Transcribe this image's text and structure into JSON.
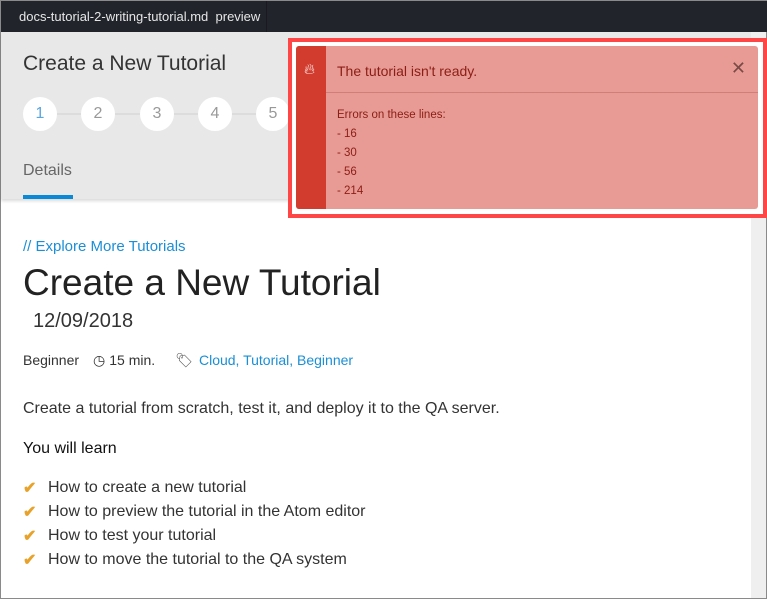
{
  "tab": {
    "title": "docs-tutorial-2-writing-tutorial.md  preview"
  },
  "header": {
    "title": "Create a New Tutorial",
    "steps": [
      "1",
      "2",
      "3",
      "4",
      "5"
    ],
    "active_tab": "Details"
  },
  "content": {
    "link": "// Explore More Tutorials",
    "title": "Create a New Tutorial",
    "date": "12/09/2018",
    "level": "Beginner",
    "time": "15 min.",
    "tags": "Cloud, Tutorial, Beginner",
    "description": "Create a tutorial from scratch, test it, and deploy it to the QA server.",
    "learn_heading": "You will learn",
    "learn_items": [
      "How to create a new tutorial",
      "How to preview the tutorial in the Atom editor",
      "How to test your tutorial",
      "How to move the tutorial to the QA system"
    ]
  },
  "notification": {
    "title": "The tutorial isn't ready.",
    "heading": "Errors on these lines:",
    "lines": [
      "- 16",
      "- 30",
      "- 56",
      "- 214"
    ],
    "icon": "fire-icon",
    "color": "#d13c2e"
  }
}
